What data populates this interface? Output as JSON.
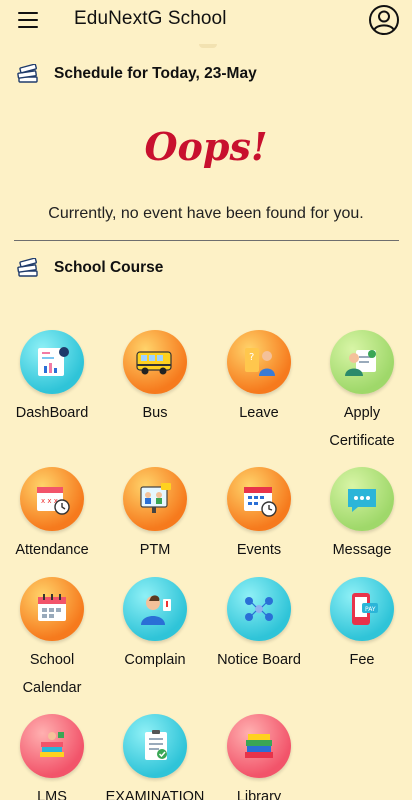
{
  "header": {
    "title": "EduNextG School",
    "menu_icon": "hamburger-menu-icon",
    "profile_icon": "account-circle-icon"
  },
  "schedule": {
    "heading": "Schedule for Today, 23-May",
    "icon": "books-stack-icon"
  },
  "empty_state": {
    "oops": "Oops!",
    "message": "Currently, no event have been found for you."
  },
  "course": {
    "heading": "School Course",
    "icon": "books-stack-icon"
  },
  "colors": {
    "background": "#fdf1c6",
    "oops_red": "#c8102e",
    "orange": "#f67a1d",
    "cyan": "#2fc4d8",
    "green": "#9fd86a",
    "pink": "#f2546a"
  },
  "tiles": [
    {
      "label": "DashBoard",
      "icon": "dashboard-icon"
    },
    {
      "label": "Bus",
      "icon": "bus-icon"
    },
    {
      "label": "Leave",
      "icon": "leave-icon"
    },
    {
      "label": "Apply Certificate",
      "icon": "certificate-icon"
    },
    {
      "label": "Attendance",
      "icon": "attendance-calendar-icon"
    },
    {
      "label": "PTM",
      "icon": "ptm-meeting-icon"
    },
    {
      "label": "Events",
      "icon": "events-calendar-icon"
    },
    {
      "label": "Message",
      "icon": "message-bubble-icon"
    },
    {
      "label": "School Calendar",
      "icon": "school-calendar-icon"
    },
    {
      "label": "Complain",
      "icon": "complain-icon"
    },
    {
      "label": "Notice Board",
      "icon": "notice-board-icon"
    },
    {
      "label": "Fee",
      "icon": "fee-payment-icon"
    },
    {
      "label": "LMS",
      "icon": "lms-icon"
    },
    {
      "label": "EXAMINATION",
      "icon": "examination-icon"
    },
    {
      "label": "Library",
      "icon": "library-books-icon"
    }
  ]
}
